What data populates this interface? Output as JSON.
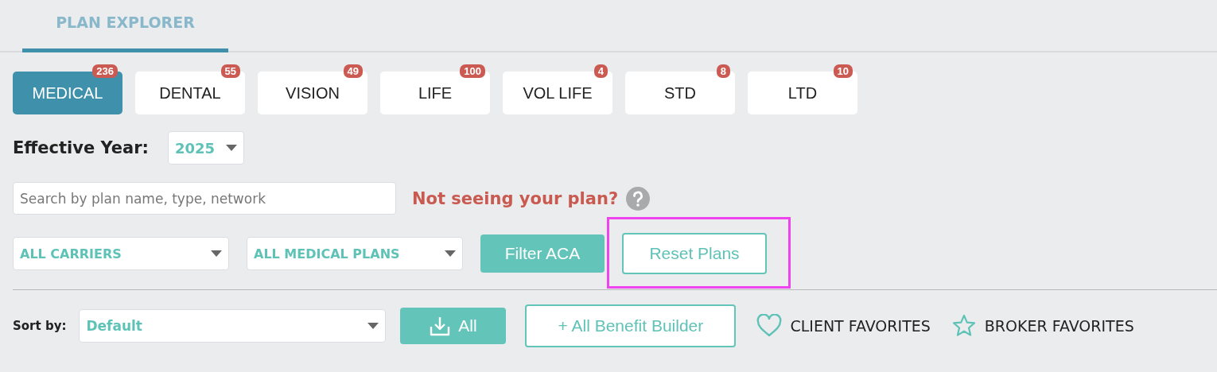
{
  "header_tab": {
    "label": "PLAN EXPLORER",
    "selected": true
  },
  "categories": [
    {
      "label": "MEDICAL",
      "count": "236",
      "selected": true
    },
    {
      "label": "DENTAL",
      "count": "55",
      "selected": false
    },
    {
      "label": "VISION",
      "count": "49",
      "selected": false
    },
    {
      "label": "LIFE",
      "count": "100",
      "selected": false
    },
    {
      "label": "VOL LIFE",
      "count": "4",
      "selected": false
    },
    {
      "label": "STD",
      "count": "8",
      "selected": false
    },
    {
      "label": "LTD",
      "count": "10",
      "selected": false
    }
  ],
  "effective_year": {
    "label": "Effective Year:",
    "value": "2025"
  },
  "search": {
    "placeholder": "Search by plan name, type, network"
  },
  "help_link": "Not seeing your plan?",
  "filters": [
    {
      "value": "ALL CARRIERS"
    },
    {
      "value": "ALL MEDICAL PLANS"
    }
  ],
  "filter_button": "Filter ACA",
  "reset_button": {
    "label": "Reset Plans",
    "highlighted": true
  },
  "sort": {
    "label": "Sort by:",
    "value": "Default"
  },
  "download_button": "All",
  "builder_button": "+ All Benefit Builder",
  "favorites": [
    {
      "kind": "heart",
      "label": "CLIENT FAVORITES"
    },
    {
      "kind": "star",
      "label": "BROKER FAVORITES"
    }
  ]
}
